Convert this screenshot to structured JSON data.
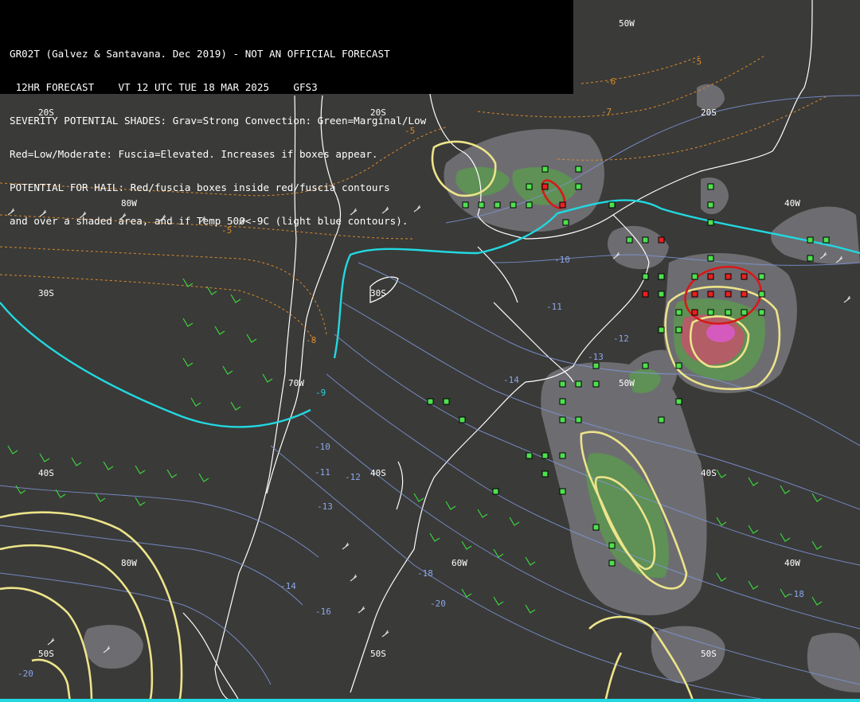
{
  "header": {
    "line1": "GR02T (Galvez & Santavana. Dec 2019) - NOT AN OFFICIAL FORECAST",
    "line2": " 12HR FORECAST    VT 12 UTC TUE 18 MAR 2025    GFS3",
    "line3": "SEVERITY POTENTIAL SHADES: Grav=Strong Convection: Green=Marginal/Low",
    "line4": "Red=Low/Moderate: Fuscia=Elevated. Increases if boxes appear.",
    "line5": "POTENTIAL FOR HAIL: Red/fuscia boxes inside red/fuscia contours",
    "line6": "and over a shaded area, and if Temp 500<-9C (light blue contours)."
  },
  "grid_labels": {
    "lat_20s_a": "20S",
    "lat_20s_b": "20S",
    "lat_20s_c": "20S",
    "lat_30s_a": "30S",
    "lat_30s_b": "30S",
    "lat_40s_a": "40S",
    "lat_40s_b": "40S",
    "lat_40s_c": "40S",
    "lat_50s_a": "50S",
    "lat_50s_b": "50S",
    "lat_50s_c": "50S",
    "lon_80w_a": "80W",
    "lon_80w_b": "80W",
    "lon_70w": "70W",
    "lon_60w": "60W",
    "lon_50w_a": "50W",
    "lon_50w_b": "50W",
    "lon_40w_a": "40W",
    "lon_40w_b": "40W"
  },
  "temp_labels": {
    "t1": "-5",
    "t2": "-6",
    "t3": "-7",
    "t4": "-5",
    "t5": "-5",
    "t6": "-8",
    "t7": "-9",
    "t8": "-10",
    "t9": "-11",
    "t10": "-12",
    "t11": "-13",
    "t12": "-14",
    "t13": "-10",
    "t14": "-11",
    "t15": "-12",
    "t16": "-13",
    "t17": "-18",
    "t18": "-20",
    "t19": "-16",
    "t20": "-14",
    "t21": "-18",
    "t22": "-20"
  },
  "colors": {
    "background": "#3a3a38",
    "header_bg": "#000000",
    "coast": "#ffffff",
    "temp_500_cold": "#22d8e0",
    "temp_contour": "#8aa6e8",
    "temp_warm_label": "#d98a2a",
    "severity_gray": "#8a8a8e",
    "severity_green": "#5aa04a",
    "severity_red": "#d04a5a",
    "severity_fuscia": "#d85ac8",
    "hail_contour": "#e8e890",
    "wind_green": "#3ed23e",
    "wind_white": "#e8e8e8"
  }
}
